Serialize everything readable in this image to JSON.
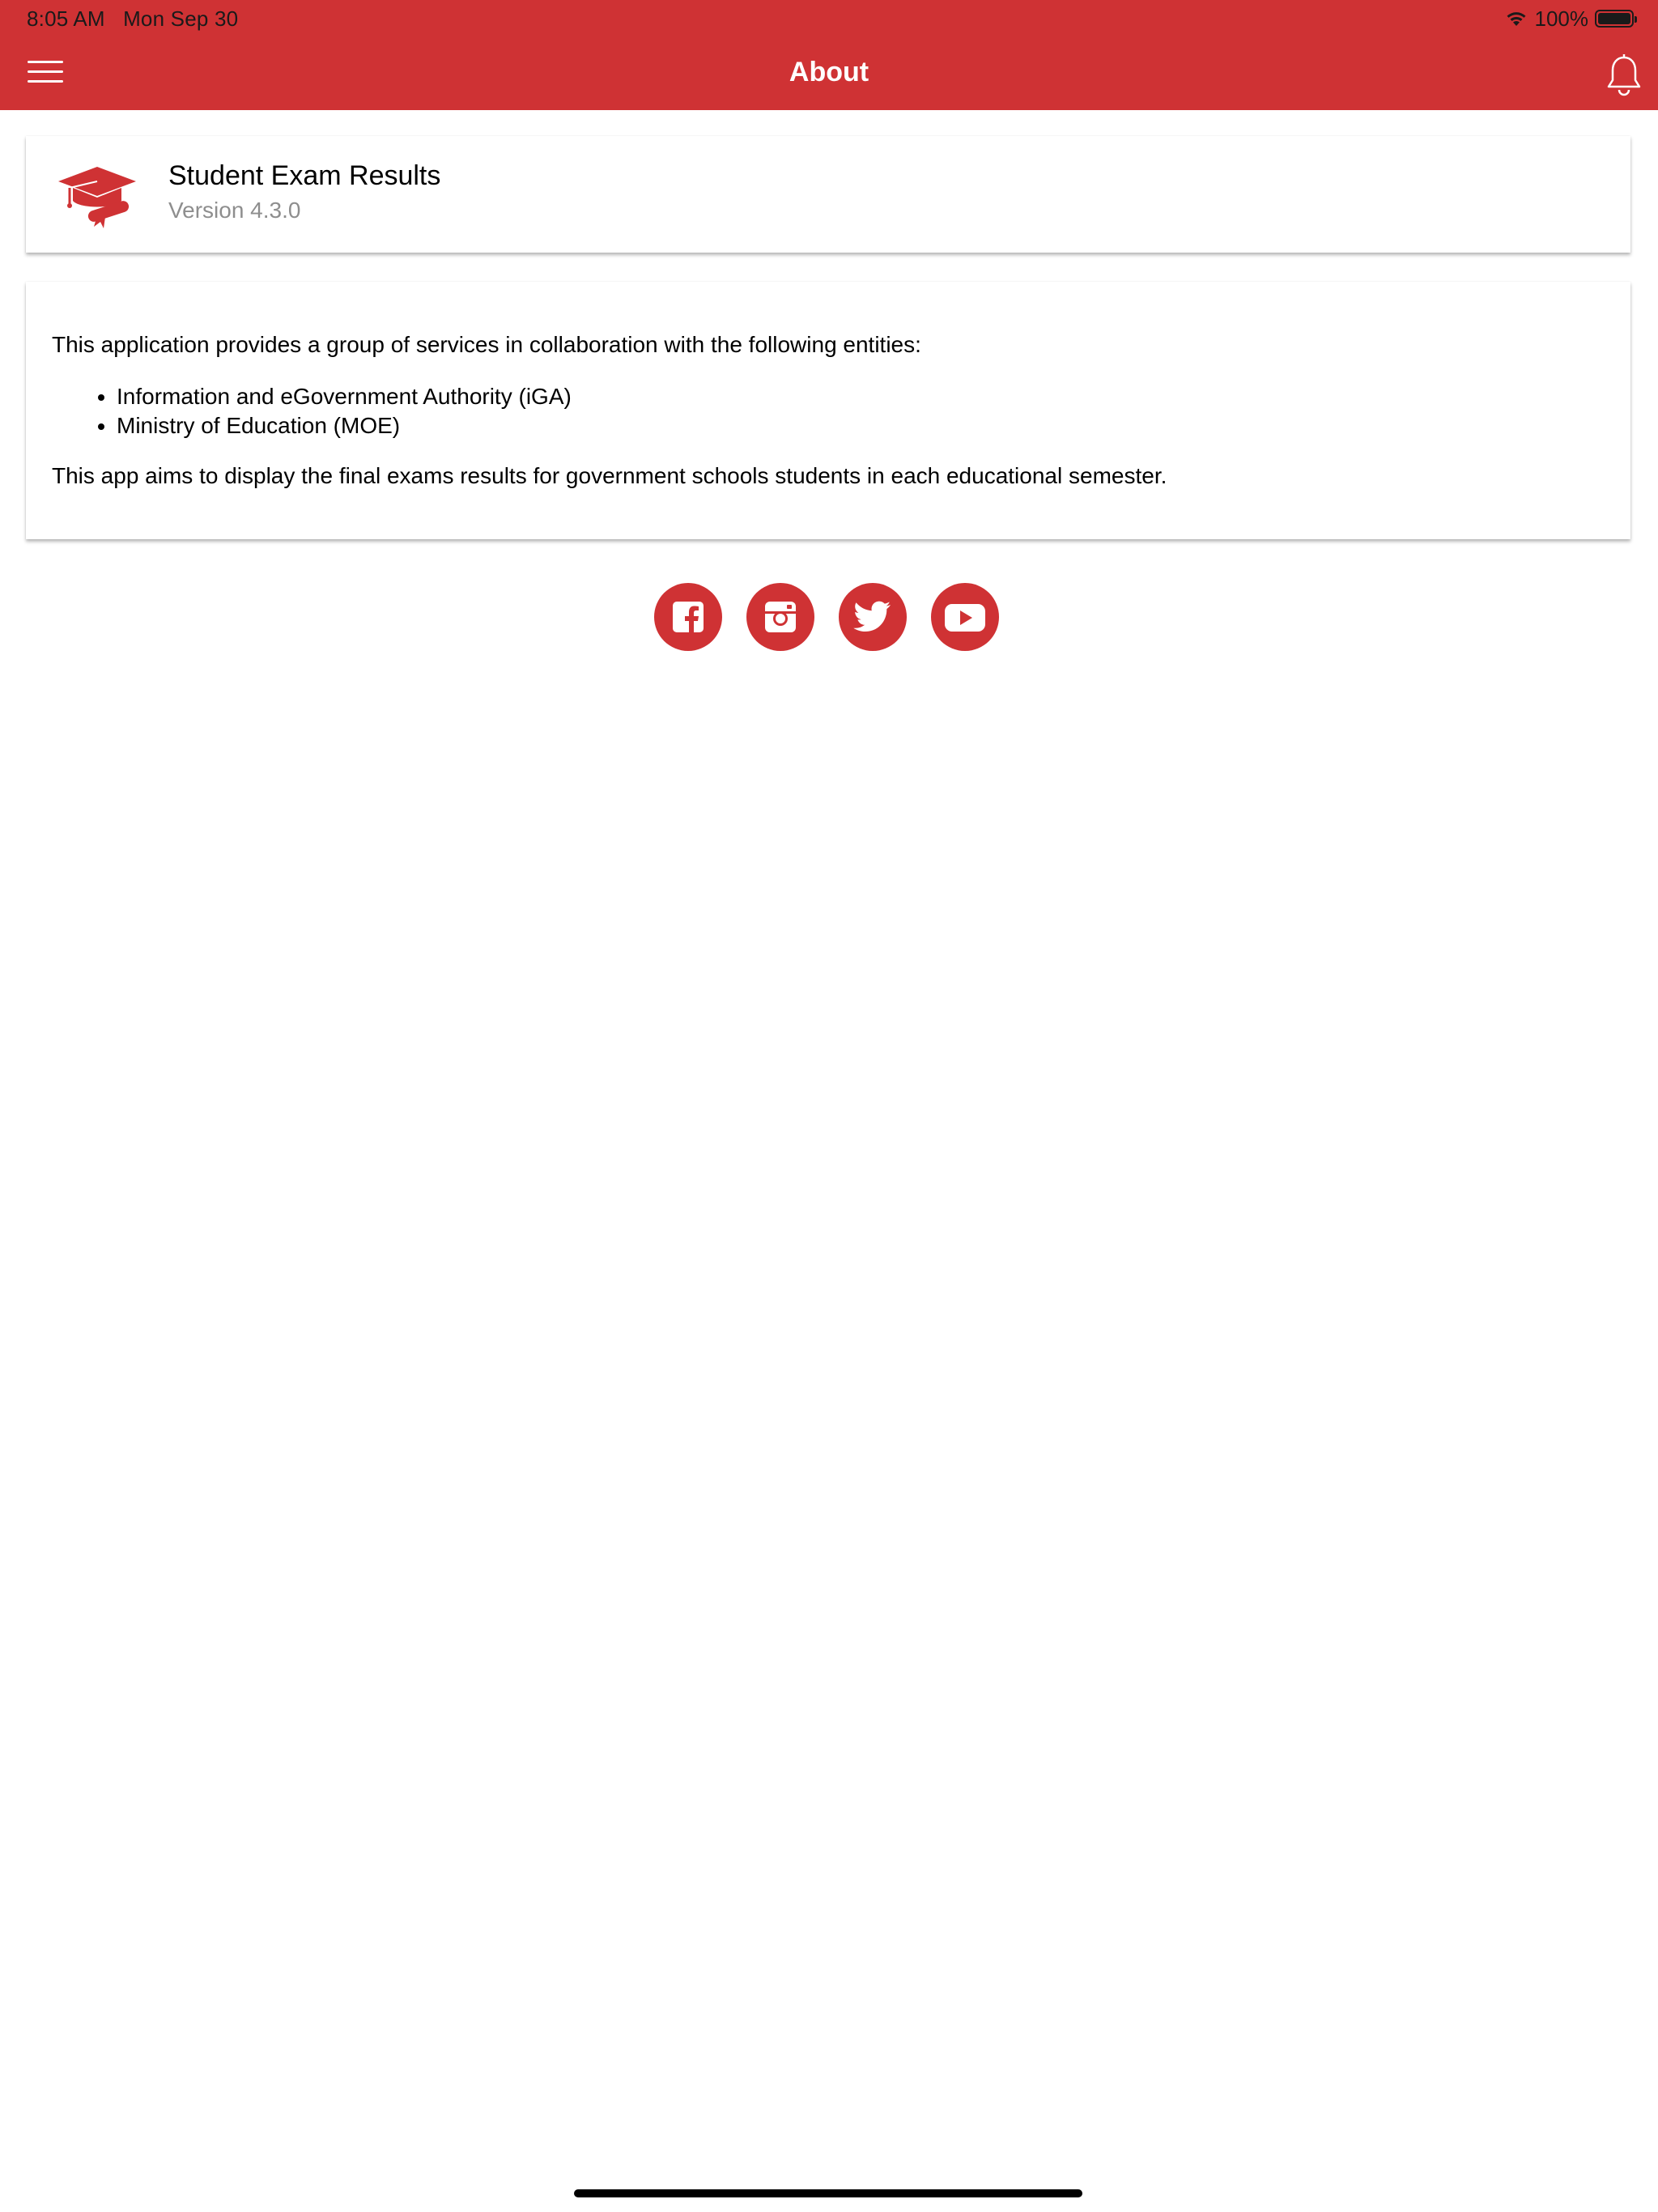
{
  "status_bar": {
    "time": "8:05 AM",
    "date": "Mon Sep 30",
    "battery": "100%",
    "battery_level": 1.0
  },
  "nav": {
    "title": "About",
    "menu_icon": "hamburger-menu-icon",
    "notification_icon": "bell-icon"
  },
  "app_card": {
    "name": "Student Exam Results",
    "version": "Version 4.3.0",
    "logo_icon": "graduation-cap-icon"
  },
  "info": {
    "intro": "This application provides a group of services in collaboration with the following entities:",
    "entities": [
      "Information and eGovernment Authority (iGA)",
      "Ministry of Education (MOE)"
    ],
    "description": "This app aims to display the final exams results for government schools students in each educational semester."
  },
  "social": [
    "facebook-icon",
    "instagram-icon",
    "twitter-icon",
    "youtube-icon"
  ],
  "colors": {
    "accent": "#cf3234",
    "background": "#ffffff",
    "muted_text": "#8e8e8e"
  }
}
